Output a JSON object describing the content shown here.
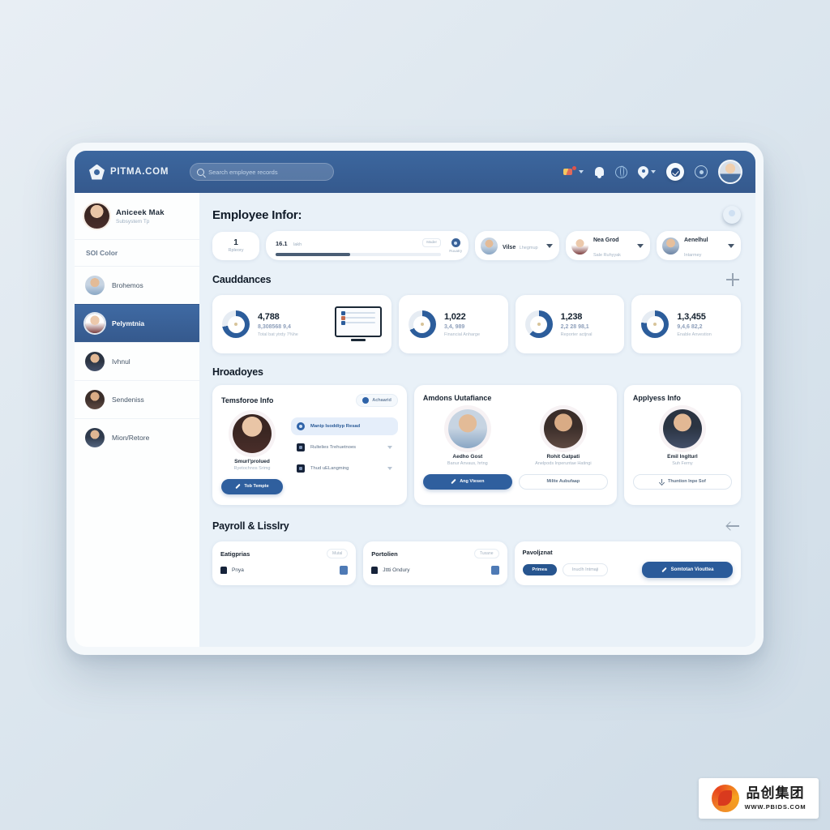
{
  "topbar": {
    "brand": "PITMA.COM",
    "search_placeholder": "Search employee records",
    "search_value": "",
    "icons": [
      {
        "name": "flag-icon",
        "label": "Language"
      },
      {
        "name": "bell-icon",
        "label": "Notifications"
      },
      {
        "name": "globe-icon",
        "label": "Network"
      },
      {
        "name": "pin-icon",
        "label": "Location"
      },
      {
        "name": "check-badge-icon",
        "label": "Verified"
      },
      {
        "name": "ring-icon",
        "label": "Status"
      },
      {
        "name": "user-avatar",
        "label": "Account"
      }
    ]
  },
  "sidebar": {
    "profile": {
      "name": "Aniceek Mak",
      "role": "Subsystem Tp"
    },
    "section_label": "SOI Color",
    "items": [
      {
        "label": "Brohemos",
        "active": false
      },
      {
        "label": "Pelymtnia",
        "active": true
      },
      {
        "label": "Ivhnul",
        "active": false
      },
      {
        "label": "Sendeniss",
        "active": false
      },
      {
        "label": "Mion/Retore",
        "active": false
      }
    ]
  },
  "main": {
    "page_title": "Employee Infor:",
    "filters": {
      "count_value": "1",
      "count_label": "Rpleory",
      "progress_value": "16.1",
      "progress_unit": "lakh",
      "progress_chip": "Mader",
      "progress_percent": 45,
      "progress_icon_caption": "Ruuatry",
      "selects": [
        {
          "name": "Vilse",
          "sub": "Lhegmup"
        },
        {
          "name": "Nea Grod",
          "sub": "Sale Ruhyyak"
        },
        {
          "name": "Aenelhul",
          "sub": "Intarmey"
        }
      ]
    },
    "attendances": {
      "title": "Cauddances",
      "add_icon": "plus-icon",
      "cards": [
        {
          "value": "4,788",
          "sub": "8,308568 9,4",
          "caption": "Total bat ytrdy 7%he",
          "percent": 72,
          "illustration": "monitor"
        },
        {
          "value": "1,022",
          "sub": "3,4, 989",
          "caption": "Financial Anharge",
          "percent": 68
        },
        {
          "value": "1,238",
          "sub": "2,2 28 98,1",
          "caption": "Reporter actjnal",
          "percent": 62
        },
        {
          "value": "1,3,455",
          "sub": "9,4,6 82,2",
          "caption": "Enable Anvestion",
          "percent": 77
        }
      ]
    },
    "employees": {
      "title": "Hroadoyes",
      "card1": {
        "title": "Temsforoe Info",
        "badge": "Achaarid",
        "person": {
          "name": "Smurl'prolued",
          "role": "Ryetochnos Srimg"
        },
        "button": "Tob Tempte",
        "list": [
          {
            "label": "Manip Isoddiyp Resad",
            "active": true,
            "icon": "dot-circle-icon"
          },
          {
            "label": "Rultelies Trehuetnoes",
            "active": false,
            "icon": "square-icon"
          },
          {
            "label": "Thud uELangming",
            "active": false,
            "icon": "square-icon"
          }
        ]
      },
      "card2": {
        "title": "Amdons Uutafiance",
        "people": [
          {
            "name": "Aedho Gost",
            "role": "Banur Anvaus, hrtng",
            "button": "Ang Vtesen",
            "style": "primary"
          },
          {
            "name": "Rohit Gatpati",
            "role": "Anelpods Inperuntae Hatingi",
            "button": "Milite Aubufaap",
            "style": "outline"
          }
        ]
      },
      "card3": {
        "title": "Applyess Info",
        "person": {
          "name": "Emil Inglturl",
          "role": "Suh Ferny"
        },
        "button": "Thuntion Inpe Sof"
      }
    },
    "payroll": {
      "title": "Payroll & Lisslry",
      "back_icon": "arrow-left-icon",
      "cards": [
        {
          "title": "Eatigprias",
          "chip": "Mutal",
          "row_label": "Pnya"
        },
        {
          "title": "Portolien",
          "chip": "Tuxane",
          "row_label": "Jttti Ondury"
        },
        {
          "title": "Pavoljznat",
          "pill_solid": "Primea",
          "pill_outline": "Inuclh Intmaji",
          "cta": "Somtotan Viouttea"
        }
      ]
    }
  },
  "watermark": {
    "cn": "品创集团",
    "url": "WWW.PBIDS.COM"
  }
}
